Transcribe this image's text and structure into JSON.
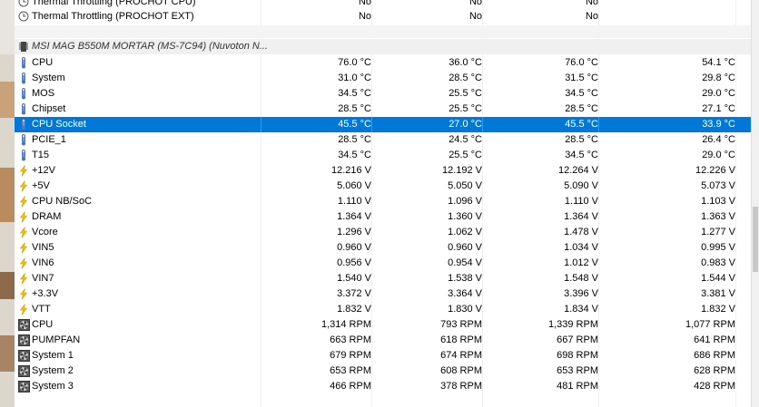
{
  "top_rows": [
    {
      "label": "Thermal Throttling (PROCHOT CPU)",
      "v1": "No",
      "v2": "No",
      "v3": "No",
      "v4": ""
    },
    {
      "label": "Thermal Throttling (PROCHOT EXT)",
      "v1": "No",
      "v2": "No",
      "v3": "No",
      "v4": ""
    }
  ],
  "device": {
    "label": "MSI MAG B550M MORTAR (MS-7C94) (Nuvoton N..."
  },
  "rows": [
    {
      "icon": "thermometer-icon",
      "label": "CPU",
      "v1": "76.0 °C",
      "v2": "36.0 °C",
      "v3": "76.0 °C",
      "v4": "54.1 °C"
    },
    {
      "icon": "thermometer-icon",
      "label": "System",
      "v1": "31.0 °C",
      "v2": "28.5 °C",
      "v3": "31.5 °C",
      "v4": "29.8 °C"
    },
    {
      "icon": "thermometer-icon",
      "label": "MOS",
      "v1": "34.5 °C",
      "v2": "25.5 °C",
      "v3": "34.5 °C",
      "v4": "29.0 °C"
    },
    {
      "icon": "thermometer-icon",
      "label": "Chipset",
      "v1": "28.5 °C",
      "v2": "25.5 °C",
      "v3": "28.5 °C",
      "v4": "27.1 °C"
    },
    {
      "icon": "thermometer-icon",
      "label": "CPU Socket",
      "v1": "45.5 °C",
      "v2": "27.0 °C",
      "v3": "45.5 °C",
      "v4": "33.9 °C",
      "selected": true
    },
    {
      "icon": "thermometer-icon",
      "label": "PCIE_1",
      "v1": "28.5 °C",
      "v2": "24.5 °C",
      "v3": "28.5 °C",
      "v4": "26.4 °C"
    },
    {
      "icon": "thermometer-icon",
      "label": "T15",
      "v1": "34.5 °C",
      "v2": "25.5 °C",
      "v3": "34.5 °C",
      "v4": "29.0 °C"
    },
    {
      "icon": "lightning-icon",
      "label": "+12V",
      "v1": "12.216 V",
      "v2": "12.192 V",
      "v3": "12.264 V",
      "v4": "12.226 V"
    },
    {
      "icon": "lightning-icon",
      "label": "+5V",
      "v1": "5.060 V",
      "v2": "5.050 V",
      "v3": "5.090 V",
      "v4": "5.073 V"
    },
    {
      "icon": "lightning-icon",
      "label": "CPU NB/SoC",
      "v1": "1.110 V",
      "v2": "1.096 V",
      "v3": "1.110 V",
      "v4": "1.103 V"
    },
    {
      "icon": "lightning-icon",
      "label": "DRAM",
      "v1": "1.364 V",
      "v2": "1.360 V",
      "v3": "1.364 V",
      "v4": "1.363 V"
    },
    {
      "icon": "lightning-icon",
      "label": "Vcore",
      "v1": "1.296 V",
      "v2": "1.062 V",
      "v3": "1.478 V",
      "v4": "1.277 V"
    },
    {
      "icon": "lightning-icon",
      "label": "VIN5",
      "v1": "0.960 V",
      "v2": "0.960 V",
      "v3": "1.034 V",
      "v4": "0.995 V"
    },
    {
      "icon": "lightning-icon",
      "label": "VIN6",
      "v1": "0.956 V",
      "v2": "0.954 V",
      "v3": "1.012 V",
      "v4": "0.983 V"
    },
    {
      "icon": "lightning-icon",
      "label": "VIN7",
      "v1": "1.540 V",
      "v2": "1.538 V",
      "v3": "1.548 V",
      "v4": "1.544 V"
    },
    {
      "icon": "lightning-icon",
      "label": "+3.3V",
      "v1": "3.372 V",
      "v2": "3.364 V",
      "v3": "3.396 V",
      "v4": "3.381 V"
    },
    {
      "icon": "lightning-icon",
      "label": "VTT",
      "v1": "1.832 V",
      "v2": "1.830 V",
      "v3": "1.834 V",
      "v4": "1.832 V"
    },
    {
      "icon": "fan-icon",
      "label": "CPU",
      "v1": "1,314 RPM",
      "v2": "793 RPM",
      "v3": "1,339 RPM",
      "v4": "1,077 RPM"
    },
    {
      "icon": "fan-icon",
      "label": "PUMPFAN",
      "v1": "663 RPM",
      "v2": "618 RPM",
      "v3": "667 RPM",
      "v4": "641 RPM"
    },
    {
      "icon": "fan-icon",
      "label": "System 1",
      "v1": "679 RPM",
      "v2": "674 RPM",
      "v3": "698 RPM",
      "v4": "686 RPM"
    },
    {
      "icon": "fan-icon",
      "label": "System 2",
      "v1": "653 RPM",
      "v2": "608 RPM",
      "v3": "653 RPM",
      "v4": "628 RPM"
    },
    {
      "icon": "fan-icon",
      "label": "System 3",
      "v1": "466 RPM",
      "v2": "378 RPM",
      "v3": "481 RPM",
      "v4": "428 RPM"
    }
  ],
  "colors": {
    "selection": "#0078d7",
    "lightning": "#f5c400",
    "thermometer": "#4a78b8"
  }
}
